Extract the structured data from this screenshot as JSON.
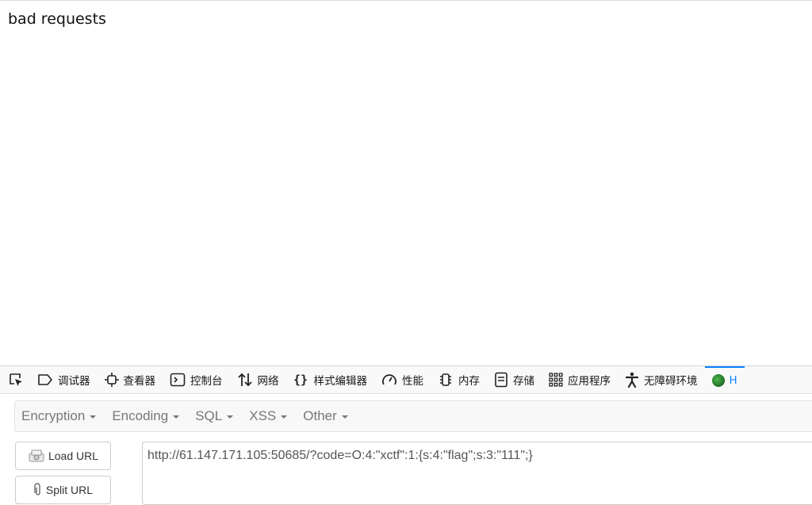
{
  "page": {
    "body_text": "bad requests"
  },
  "devtools": {
    "tabs": [
      {
        "label": "调试器",
        "icon": "debugger-icon"
      },
      {
        "label": "查看器",
        "icon": "inspector-icon"
      },
      {
        "label": "控制台",
        "icon": "console-icon"
      },
      {
        "label": "网络",
        "icon": "network-icon"
      },
      {
        "label": "样式编辑器",
        "icon": "style-editor-icon"
      },
      {
        "label": "性能",
        "icon": "performance-icon"
      },
      {
        "label": "内存",
        "icon": "memory-icon"
      },
      {
        "label": "存储",
        "icon": "storage-icon"
      },
      {
        "label": "应用程序",
        "icon": "application-icon"
      },
      {
        "label": "无障碍环境",
        "icon": "accessibility-icon"
      },
      {
        "label": "H",
        "icon": "hackbar-icon"
      }
    ],
    "active_color": "#0a84ff"
  },
  "hackbar": {
    "menu": [
      "Encryption",
      "Encoding",
      "SQL",
      "XSS",
      "Other"
    ],
    "load_url_label": "Load URL",
    "split_url_label": "Split URL",
    "url_value": "http://61.147.171.105:50685/?code=O:4:\"xctf\":1:{s:4:\"flag\";s:3:\"111\";}"
  }
}
